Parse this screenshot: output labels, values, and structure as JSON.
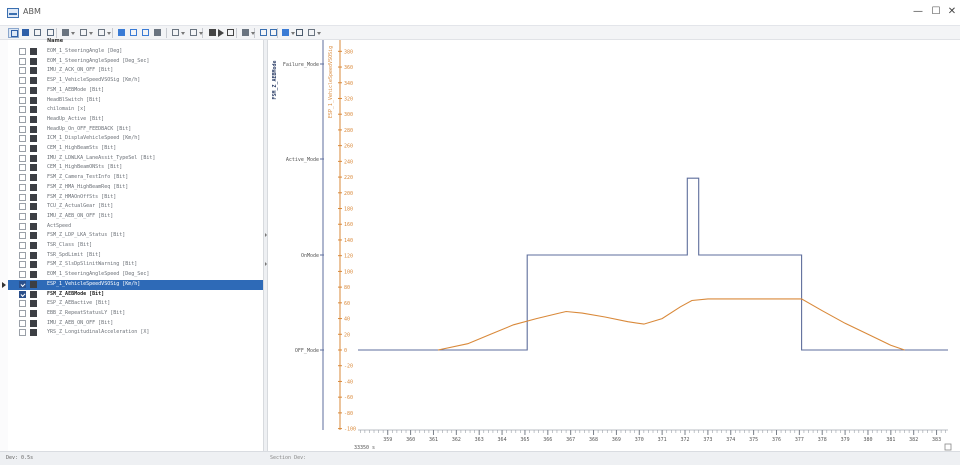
{
  "window": {
    "title": "ABM",
    "min_glyph": "—",
    "max_glyph": "☐",
    "close_glyph": "✕"
  },
  "toolbar": {
    "icons": [
      "cursor-icon",
      "cursor-alt-icon",
      "list-view-icon",
      "grid-view-icon",
      "signal-menu-icon",
      "offset-menu-icon",
      "chart-menu-icon",
      "zoom-in-icon",
      "zoom-fit-icon",
      "zoom-region-icon",
      "measure-icon",
      "trigger-menu-icon",
      "marker-menu-icon",
      "step-back-icon",
      "play-icon",
      "step-forward-icon",
      "layout-menu-icon",
      "undo-icon",
      "redo-icon",
      "export-menu-icon",
      "table-icon",
      "settings-menu-icon"
    ]
  },
  "signal_list": {
    "header": "Name",
    "rows": [
      {
        "label": "EOM_1_SteeringAngle [Deg]",
        "checked": false
      },
      {
        "label": "EOM_1_SteeringAngleSpeed [Deg_Sec]",
        "checked": false
      },
      {
        "label": "IMU_Z_ACK_ON_OFF [Bit]",
        "checked": false
      },
      {
        "label": "ESP_1_VehicleSpeedVSOSig [Km/h]",
        "checked": false
      },
      {
        "label": "FSM_1_AEBMode [Bit]",
        "checked": false
      },
      {
        "label": "HeadBlSwitch [Bit]",
        "checked": false
      },
      {
        "label": "chilomain [x]",
        "checked": false
      },
      {
        "label": "HeadUp_Active [Bit]",
        "checked": false
      },
      {
        "label": "HeadUp_On_OFF_FEEDBACK [Bit]",
        "checked": false
      },
      {
        "label": "ICM_1_DisplaVehicleSpeed [Km/h]",
        "checked": false
      },
      {
        "label": "CEM_1_HighBeamSts [Bit]",
        "checked": false
      },
      {
        "label": "IMU_Z_LDWLKA_LaneAssit_TypeSel [Bit]",
        "checked": false
      },
      {
        "label": "CEM_1_HighBeamONSts [Bit]",
        "checked": false
      },
      {
        "label": "FSM_Z_Camera_TestInfo [Bit]",
        "checked": false
      },
      {
        "label": "FSM_Z_HMA_HighBeamReq [Bit]",
        "checked": false
      },
      {
        "label": "FSM_Z_HMAOnOffSts [Bit]",
        "checked": false
      },
      {
        "label": "TCU_Z_ActualGear [Bit]",
        "checked": false
      },
      {
        "label": "IMU_Z_AEB_ON_OFF [Bit]",
        "checked": false
      },
      {
        "label": "ActSpeed",
        "checked": false
      },
      {
        "label": "FSM_Z_LDP_LKA_Status [Bit]",
        "checked": false
      },
      {
        "label": "TSR_Class [Bit]",
        "checked": false
      },
      {
        "label": "TSR_SpdLimit [Bit]",
        "checked": false
      },
      {
        "label": "FSM_Z_SlsDpSlinitWarning [Bit]",
        "checked": false
      },
      {
        "label": "EOM_1_SteeringAngleSpeed [Deg_Sec]",
        "checked": false
      },
      {
        "label": "ESP_1_VehicleSpeedVSOSig [Km/h]",
        "checked": true,
        "selected": true
      },
      {
        "label": "FSM_Z_AEBMode [Bit]",
        "checked": true,
        "bold": true
      },
      {
        "label": "ESP_Z_AEBactive [Bit]",
        "checked": false
      },
      {
        "label": "EBB_Z_RepeatStatusLY [Bit]",
        "checked": false
      },
      {
        "label": "IMU_Z_AEB_ON_OFF [Bit]",
        "checked": false
      },
      {
        "label": "YRS_Z_LongitudinalAcceleration [X]",
        "checked": false
      }
    ]
  },
  "chart_data": {
    "type": "line",
    "left_axis": {
      "label": "FSM_Z_AEBMode",
      "states": [
        "OFF_Mode",
        "OnMode",
        "Active_Mode",
        "Failure_Mode"
      ],
      "color": "#5e6e9c"
    },
    "right_axis": {
      "label": "ESP_1_VehicleSpeedVSOSig",
      "min": -140,
      "max": 400,
      "step": 20,
      "color": "#d9893a"
    },
    "x_axis": {
      "min": 357.7,
      "max": 383.5,
      "ticks": [
        359,
        360,
        361,
        362,
        363,
        364,
        365,
        366,
        367,
        368,
        369,
        370,
        371,
        372,
        373,
        374,
        375,
        376,
        377,
        378,
        379,
        380,
        381,
        382,
        383
      ],
      "origin_label": "33350 s"
    },
    "series": [
      {
        "axis": "left",
        "color": "#5e6e9c",
        "points": [
          [
            357.7,
            0
          ],
          [
            365.1,
            0
          ],
          [
            365.1,
            1
          ],
          [
            372.1,
            1
          ],
          [
            372.1,
            1.8
          ],
          [
            372.6,
            1.8
          ],
          [
            372.6,
            1
          ],
          [
            377.1,
            1
          ],
          [
            377.1,
            0
          ],
          [
            383.5,
            0
          ]
        ]
      },
      {
        "axis": "right",
        "color": "#d9893a",
        "points": [
          [
            361.2,
            0
          ],
          [
            362.5,
            8
          ],
          [
            363.5,
            20
          ],
          [
            364.5,
            32
          ],
          [
            365.5,
            40
          ],
          [
            366.5,
            47
          ],
          [
            366.8,
            49
          ],
          [
            367.5,
            47
          ],
          [
            368.5,
            42
          ],
          [
            369.5,
            36
          ],
          [
            370.2,
            33
          ],
          [
            371,
            40
          ],
          [
            371.8,
            55
          ],
          [
            372.3,
            63
          ],
          [
            373,
            65
          ],
          [
            374,
            65
          ],
          [
            375,
            65
          ],
          [
            376,
            65
          ],
          [
            377.1,
            65
          ],
          [
            378,
            50
          ],
          [
            379,
            34
          ],
          [
            380,
            20
          ],
          [
            381,
            6
          ],
          [
            381.6,
            0
          ]
        ]
      }
    ]
  },
  "statusbar": {
    "left_text": "Dev: 0.5s",
    "mid_text": "Section Dev:"
  }
}
